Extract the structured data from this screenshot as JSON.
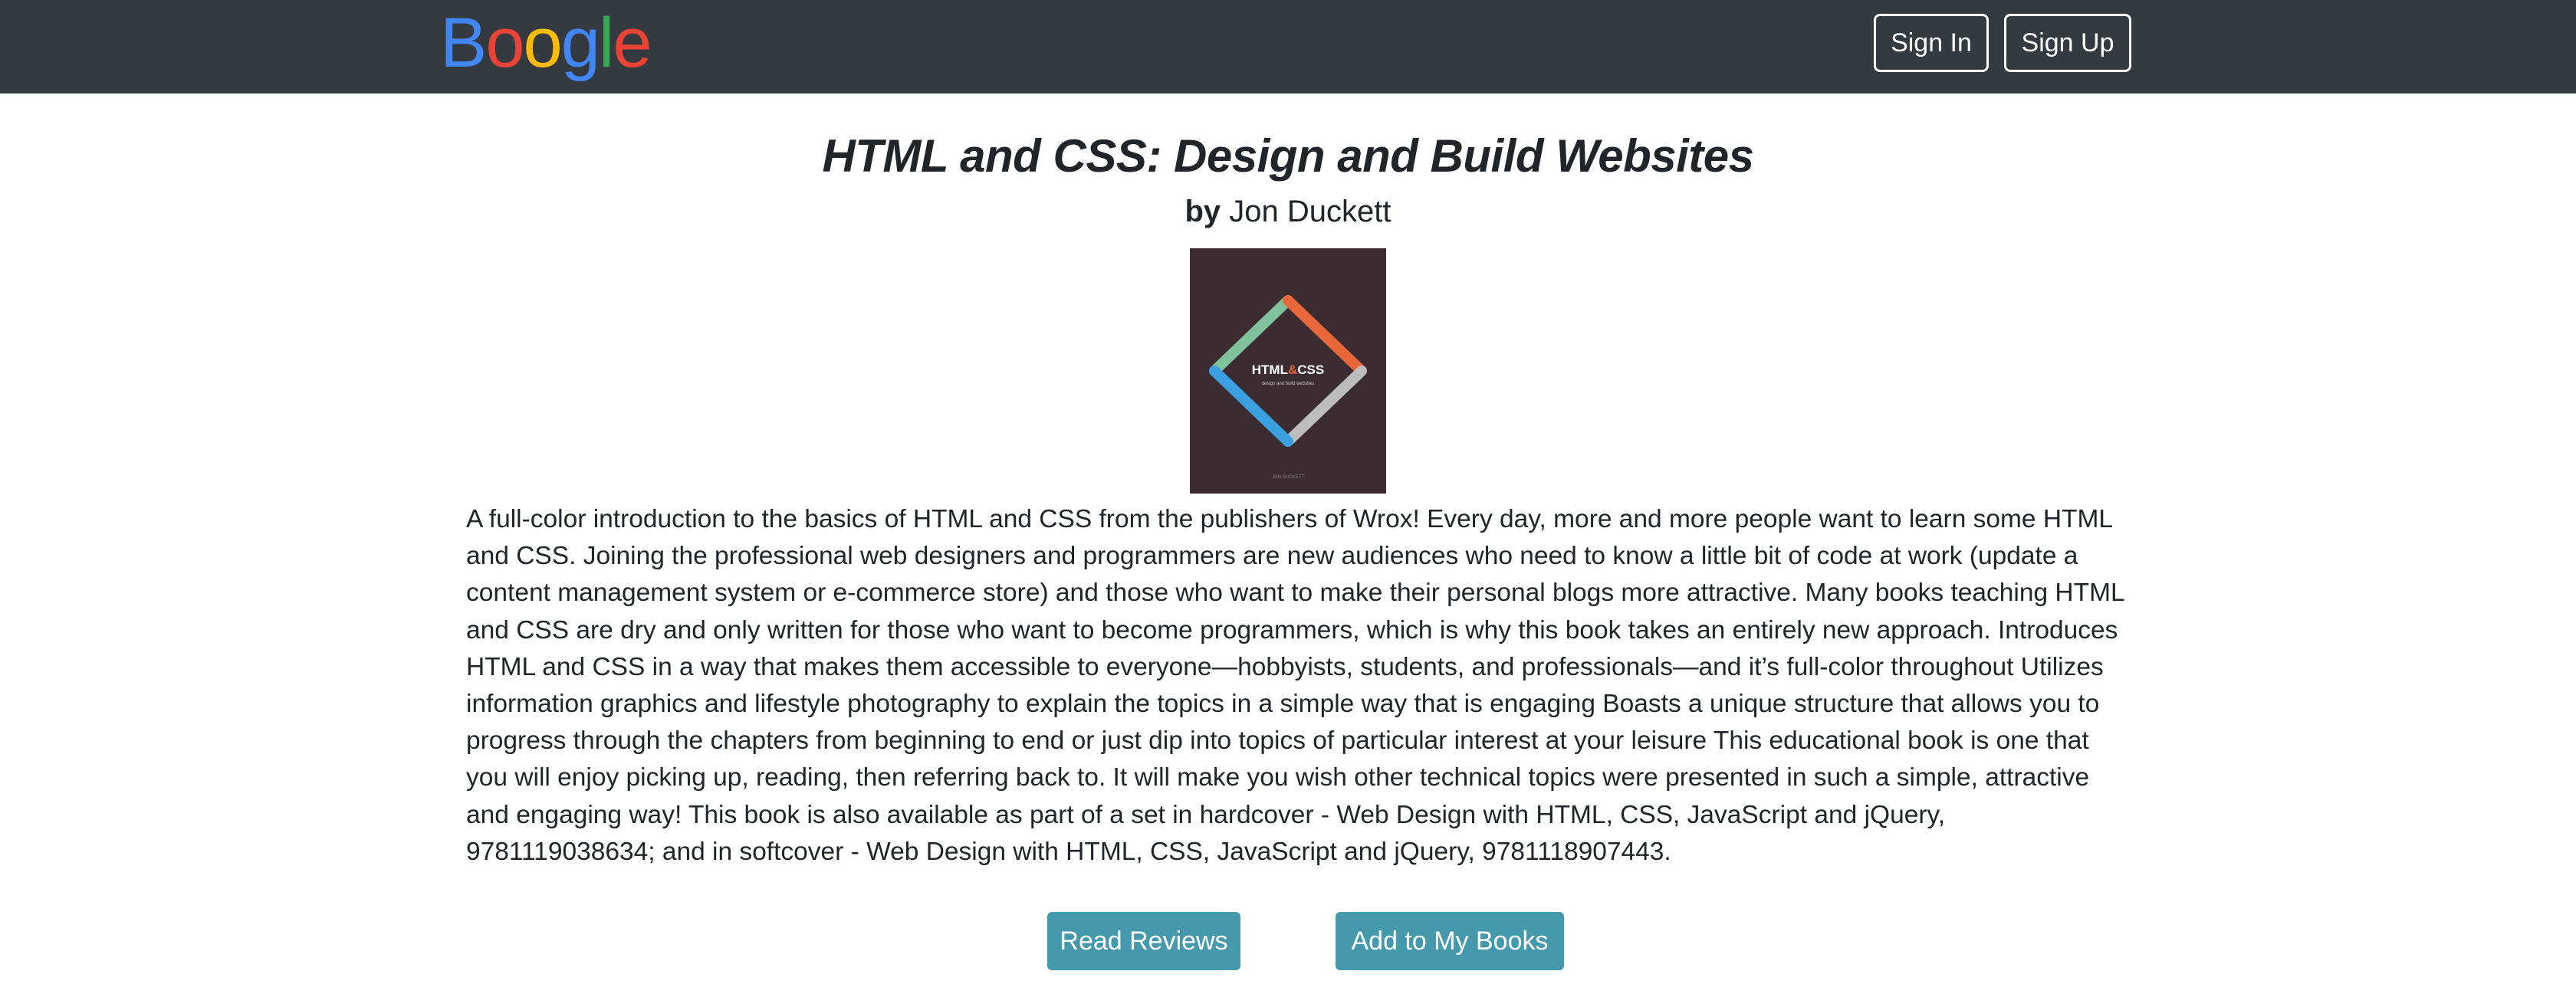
{
  "navbar": {
    "brand": {
      "letters": [
        {
          "char": "B",
          "color": "#4285F4"
        },
        {
          "char": "o",
          "color": "#EA4335"
        },
        {
          "char": "o",
          "color": "#FBBC05"
        },
        {
          "char": "g",
          "color": "#4285F4"
        },
        {
          "char": "l",
          "color": "#34A853"
        },
        {
          "char": "e",
          "color": "#EA4335"
        }
      ],
      "background": "#343a40"
    },
    "sign_in_label": "Sign In",
    "sign_up_label": "Sign Up"
  },
  "book": {
    "title": "HTML and CSS: Design and Build Websites",
    "by_label": "by",
    "author": "Jon Duckett",
    "cover": {
      "title_part1": "HTML",
      "title_amp": "&",
      "title_part2": "CSS",
      "subtitle": "design and build websites",
      "author": "JON DUCKETT",
      "background": "#3a2c30",
      "colors": [
        "#7fc29b",
        "#e8673a",
        "#bdbdbd",
        "#3aa0e0"
      ]
    },
    "description": "A full-color introduction to the basics of HTML and CSS from the publishers of Wrox! Every day, more and more people want to learn some HTML and CSS. Joining the professional web designers and programmers are new audiences who need to know a little bit of code at work (update a content management system or e-commerce store) and those who want to make their personal blogs more attractive. Many books teaching HTML and CSS are dry and only written for those who want to become programmers, which is why this book takes an entirely new approach. Introduces HTML and CSS in a way that makes them accessible to everyone—hobbyists, students, and professionals—and it’s full-color throughout Utilizes information graphics and lifestyle photography to explain the topics in a simple way that is engaging Boasts a unique structure that allows you to progress through the chapters from beginning to end or just dip into topics of particular interest at your leisure This educational book is one that you will enjoy picking up, reading, then referring back to. It will make you wish other technical topics were presented in such a simple, attractive and engaging way! This book is also available as part of a set in hardcover - Web Design with HTML, CSS, JavaScript and jQuery, 9781119038634; and in softcover - Web Design with HTML, CSS, JavaScript and jQuery, 9781118907443."
  },
  "actions": {
    "read_reviews_label": "Read Reviews",
    "add_to_books_label": "Add to My Books",
    "button_color": "#4499ad"
  }
}
